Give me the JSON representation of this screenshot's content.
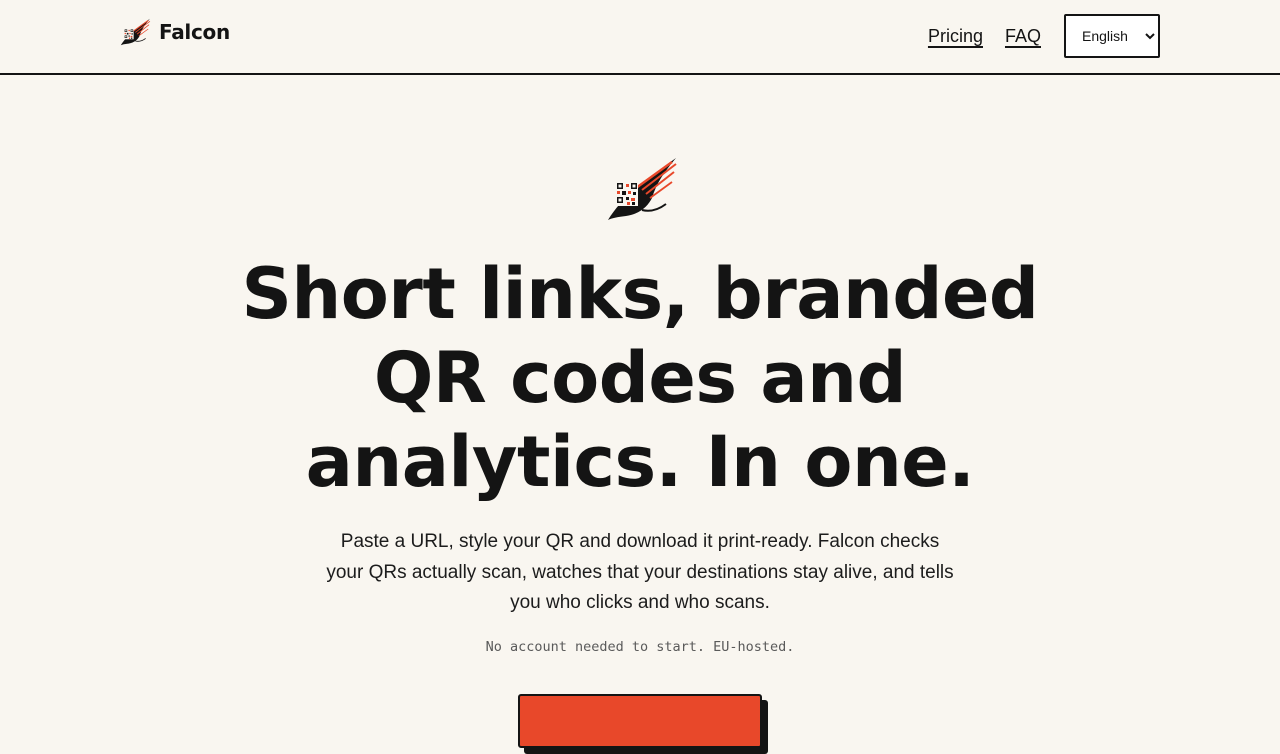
{
  "brand": {
    "name": "Falcon",
    "logo_icon": "falcon-qr-logo-icon"
  },
  "nav": {
    "links": [
      {
        "label": "Pricing"
      },
      {
        "label": "FAQ"
      }
    ],
    "language": {
      "selected": "English",
      "options": [
        "English"
      ]
    }
  },
  "hero": {
    "logo_icon": "falcon-qr-logo-icon",
    "title": "Short links, branded QR codes and analytics. In one.",
    "subtitle": "Paste a URL, style your QR and download it print-ready. Falcon checks your QRs actually scan, watches that your destinations stay alive, and tells you who clicks and who scans.",
    "note": "No account needed to start. EU-hosted.",
    "cta_label": ""
  },
  "colors": {
    "background": "#f9f6f0",
    "text": "#141414",
    "accent": "#e8482a"
  }
}
